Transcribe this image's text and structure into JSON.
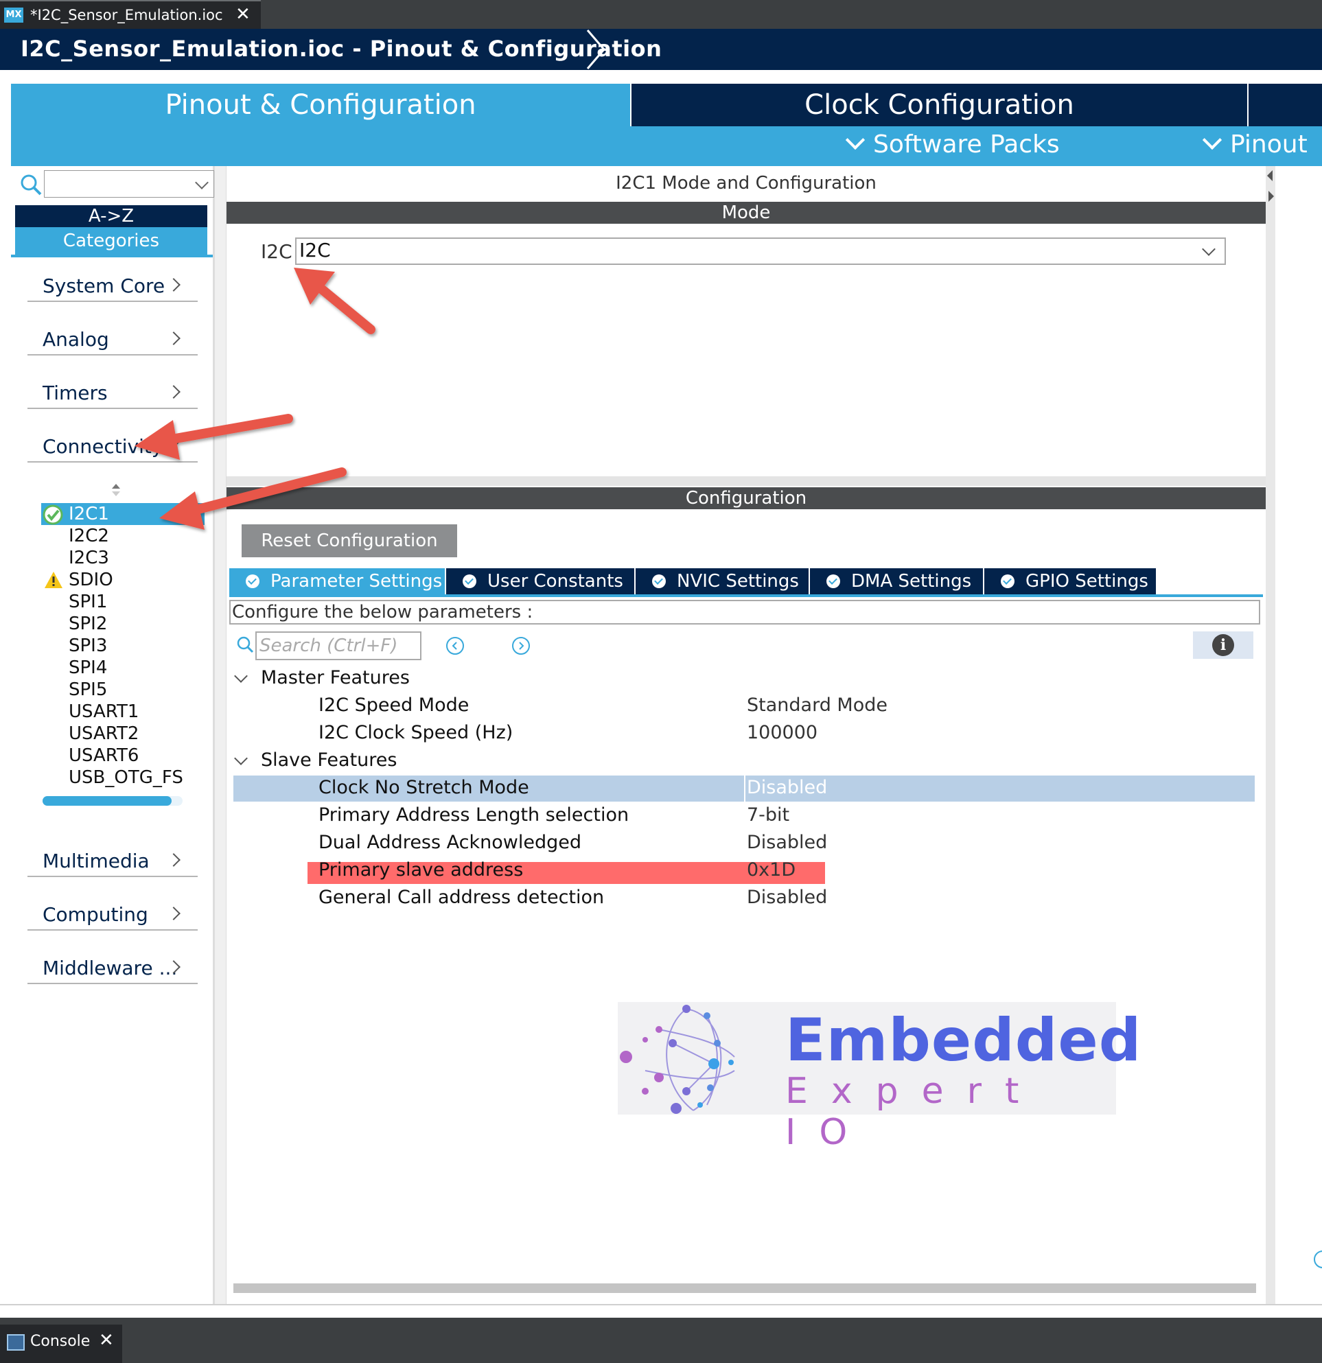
{
  "editor_tab": {
    "badge": "MX",
    "file": "*I2C_Sensor_Emulation.ioc",
    "close": "✕"
  },
  "breadcrumb": {
    "text": "I2C_Sensor_Emulation.ioc - Pinout & Configuration"
  },
  "main_tabs": {
    "pinout": "Pinout & Configuration",
    "clock": "Clock Configuration"
  },
  "subbar": {
    "software_packs": "Software Packs",
    "pinout": "Pinout"
  },
  "left": {
    "az_label": "A->Z",
    "categories_label": "Categories",
    "categories": [
      "System Core",
      "Analog",
      "Timers",
      "Connectivity",
      "Multimedia",
      "Computing",
      "Middleware ..."
    ],
    "peripherals": [
      "I2C1",
      "I2C2",
      "I2C3",
      "SDIO",
      "SPI1",
      "SPI2",
      "SPI3",
      "SPI4",
      "SPI5",
      "USART1",
      "USART2",
      "USART6",
      "USB_OTG_FS"
    ]
  },
  "main": {
    "title": "I2C1 Mode and Configuration",
    "mode_header": "Mode",
    "mode_label": "I2C",
    "mode_value": "I2C",
    "config_header": "Configuration",
    "reset_button": "Reset Configuration",
    "tabs": [
      "Parameter Settings",
      "User Constants",
      "NVIC Settings",
      "DMA Settings",
      "GPIO Settings"
    ],
    "instructions": "Configure the below parameters :",
    "search_placeholder": "Search (Ctrl+F)",
    "groups": [
      {
        "label": "Master Features",
        "rows": [
          {
            "name": "I2C Speed Mode",
            "value": "Standard Mode"
          },
          {
            "name": "I2C Clock Speed (Hz)",
            "value": "100000"
          }
        ]
      },
      {
        "label": "Slave Features",
        "rows": [
          {
            "name": "Clock No Stretch Mode",
            "value": "Disabled"
          },
          {
            "name": "Primary Address Length selection",
            "value": "7-bit"
          },
          {
            "name": "Dual Address Acknowledged",
            "value": "Disabled"
          },
          {
            "name": "Primary slave address",
            "value": "0x1D"
          },
          {
            "name": "General Call address detection",
            "value": "Disabled"
          }
        ]
      }
    ]
  },
  "logo": {
    "line1": "Embedded",
    "line2": "Expert IO"
  },
  "console": {
    "label": "Console",
    "close": "✕"
  },
  "colors": {
    "brand_dark": "#03234b",
    "brand_light": "#39a9db",
    "highlight_red": "#ff6b6b",
    "selected_row": "#b8cfe6",
    "annotation_arrow": "#e8574a"
  }
}
